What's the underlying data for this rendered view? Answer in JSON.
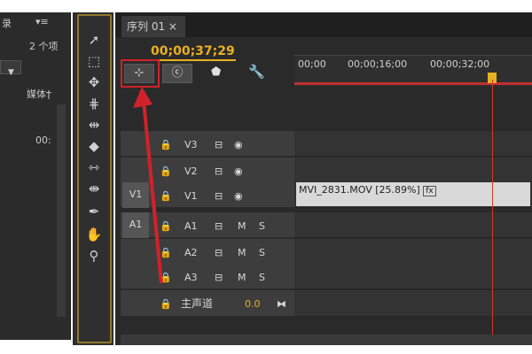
{
  "project": {
    "title_partial": "录",
    "menu": "▾≡",
    "count": "2 个项",
    "col_header": "媒体ϯ",
    "timecode_partial": "00:"
  },
  "sequence_tab": {
    "label": "序列 01",
    "close": "×"
  },
  "timecode": "00;00;37;29",
  "toolbar": {
    "snap_icon": "snap-icon",
    "marker_icon": "marker-icon",
    "wrench_icon": "wrench-icon"
  },
  "ruler": {
    "labels": [
      "00;00",
      "00;00;16;00",
      "00;00;32;00"
    ]
  },
  "tracks": [
    {
      "source": "",
      "lock": "🔒",
      "name": "V3",
      "eye": "◉"
    },
    {
      "source": "",
      "lock": "🔒",
      "name": "V2",
      "eye": "◉"
    },
    {
      "source": "V1",
      "lock": "🔒",
      "name": "V1",
      "eye": "◉"
    },
    {
      "source": "A1",
      "lock": "🔒",
      "name": "A1",
      "m": "M",
      "s": "S"
    },
    {
      "source": "",
      "lock": "🔒",
      "name": "A2",
      "m": "M",
      "s": "S"
    },
    {
      "source": "",
      "lock": "🔒",
      "name": "A3",
      "m": "M",
      "s": "S"
    }
  ],
  "master": {
    "lock": "🔒",
    "label": "主声道",
    "value": "0.0"
  },
  "clip": {
    "label": "MVI_2831.MOV [25.89%]",
    "fx": "fx"
  },
  "colors": {
    "accent": "#e8b020",
    "playhead": "#d03a2a",
    "annotation": "#d0222a"
  }
}
